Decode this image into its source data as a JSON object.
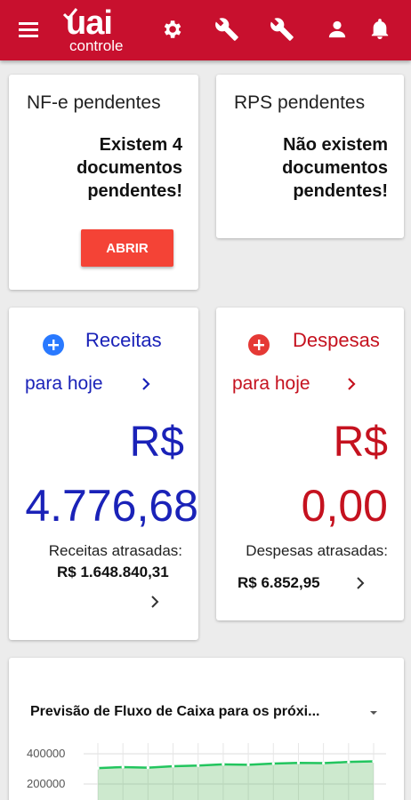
{
  "header": {
    "logo_main": "uai",
    "logo_sub": "controle",
    "icons": [
      "menu-icon",
      "gear-icon",
      "wrench-icon",
      "wrench-icon",
      "user-icon",
      "bell-icon"
    ]
  },
  "nfe_card": {
    "title": "NF-e pendentes",
    "message_lines": [
      "Existem 4",
      "documentos",
      "pendentes!"
    ],
    "button_label": "ABRIR"
  },
  "rps_card": {
    "title": "RPS pendentes",
    "message_lines": [
      "Não existem",
      "documentos",
      "pendentes!"
    ]
  },
  "receitas": {
    "title": "Receitas",
    "subtitle": "para hoje",
    "currency": "R$",
    "value": "4.776,68",
    "overdue_label": "Receitas atrasadas:",
    "overdue_value": "R$ 1.648.840,31",
    "color": "#1a22b8"
  },
  "despesas": {
    "title": "Despesas",
    "subtitle": "para hoje",
    "currency": "R$",
    "value": "0,00",
    "overdue_label": "Despesas atrasadas:",
    "overdue_value": "R$ 6.852,95",
    "color": "#c5121f"
  },
  "cashflow": {
    "title": "Previsão de Fluxo de Caixa para os próxi...",
    "y_ticks": [
      "400000",
      "200000"
    ]
  },
  "chart_data": {
    "type": "area",
    "title": "Previsão de Fluxo de Caixa para os próxi...",
    "xlabel": "",
    "ylabel": "",
    "y_ticks": [
      400000,
      200000
    ],
    "grid": true,
    "series": [
      {
        "values": [
          305000,
          312000,
          308000,
          318000,
          322000,
          330000,
          327000,
          335000,
          340000,
          338000,
          346000,
          350000
        ]
      }
    ]
  }
}
